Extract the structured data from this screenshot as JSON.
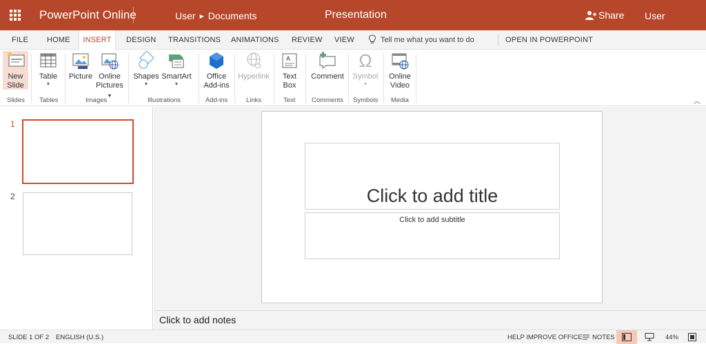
{
  "titlebar": {
    "app_name": "PowerPoint Online",
    "breadcrumb_user": "User",
    "breadcrumb_folder": "Documents",
    "doc_title": "Presentation",
    "share_label": "Share",
    "user_label": "User",
    "bg_color": "#b7472a"
  },
  "tabs": [
    {
      "label": "FILE"
    },
    {
      "label": "HOME"
    },
    {
      "label": "INSERT",
      "active": true
    },
    {
      "label": "DESIGN"
    },
    {
      "label": "TRANSITIONS"
    },
    {
      "label": "ANIMATIONS"
    },
    {
      "label": "REVIEW"
    },
    {
      "label": "VIEW"
    }
  ],
  "tell_me": "Tell me what you want to do",
  "open_in_app": "OPEN IN POWERPOINT",
  "ribbon": {
    "new_slide": {
      "line1": "New",
      "line2": "Slide",
      "icon": "new-slide-icon"
    },
    "table": {
      "label": "Table",
      "icon": "table-icon"
    },
    "picture": {
      "label": "Picture",
      "icon": "picture-icon"
    },
    "online_pictures": {
      "line1": "Online",
      "line2": "Pictures",
      "icon": "online-pictures-icon"
    },
    "shapes": {
      "label": "Shapes",
      "icon": "shapes-icon"
    },
    "smartart": {
      "label": "SmartArt",
      "icon": "smartart-icon"
    },
    "office_addins": {
      "line1": "Office",
      "line2": "Add-ins",
      "icon": "office-addins-icon"
    },
    "hyperlink": {
      "label": "Hyperlink",
      "icon": "hyperlink-icon"
    },
    "text_box": {
      "line1": "Text",
      "line2": "Box",
      "icon": "text-box-icon"
    },
    "comment": {
      "label": "Comment",
      "icon": "comment-icon"
    },
    "symbol": {
      "label": "Symbol",
      "icon": "omega-icon",
      "glyph": "Ω"
    },
    "online_video": {
      "line1": "Online",
      "line2": "Video",
      "icon": "online-video-icon"
    },
    "groups": {
      "slides": "Slides",
      "tables": "Tables",
      "images": "Images",
      "illustrations": "Illustrations",
      "addins": "Add-ins",
      "links": "Links",
      "text": "Text",
      "comments": "Comments",
      "symbols": "Symbols",
      "media": "Media"
    }
  },
  "slides": [
    {
      "number": "1",
      "selected": true
    },
    {
      "number": "2",
      "selected": false
    }
  ],
  "slide": {
    "title_placeholder": "Click to add title",
    "subtitle_placeholder": "Click to add subtitle"
  },
  "notes_placeholder": "Click to add notes",
  "status": {
    "slide_count": "SLIDE 1 OF 2",
    "language": "ENGLISH (U.S.)",
    "help": "HELP IMPROVE OFFICE",
    "notes": "NOTES",
    "zoom": "44%"
  }
}
